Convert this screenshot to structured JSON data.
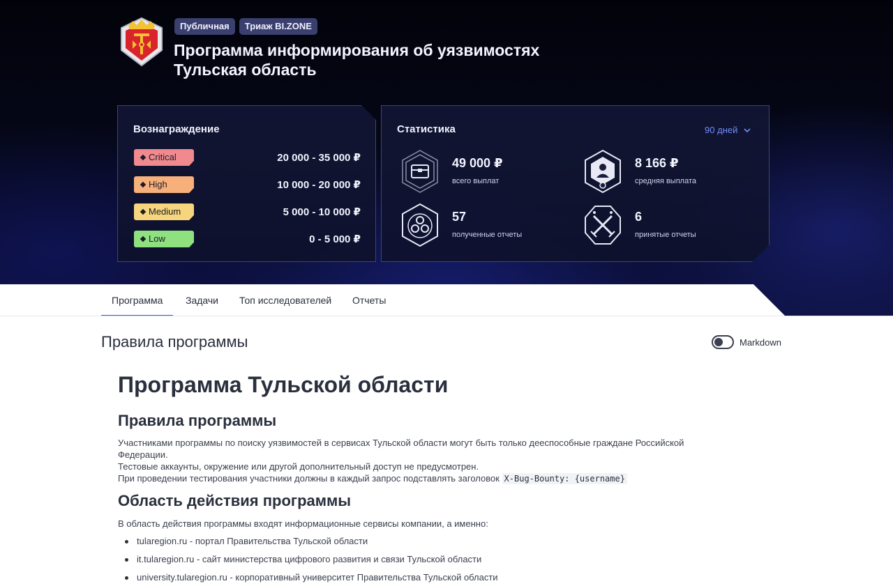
{
  "header": {
    "badges": [
      "Публичная",
      "Триаж BI.ZONE"
    ],
    "title_line1": "Программа информирования об уязвимостях",
    "title_line2": "Тульская область"
  },
  "rewards": {
    "title": "Вознаграждение",
    "rows": [
      {
        "severity": "Critical",
        "range": "20 000 - 35 000 ₽",
        "color": "#f08a8f"
      },
      {
        "severity": "High",
        "range": "10 000 - 20 000 ₽",
        "color": "#f7b07a"
      },
      {
        "severity": "Medium",
        "range": "5 000 - 10 000 ₽",
        "color": "#f7d57c"
      },
      {
        "severity": "Low",
        "range": "0 - 5 000 ₽",
        "color": "#8fe07f"
      }
    ]
  },
  "stats": {
    "title": "Статистика",
    "period": "90 дней",
    "items": [
      {
        "value": "49 000 ₽",
        "label": "всего выплат",
        "icon": "payout-chest-icon"
      },
      {
        "value": "8 166 ₽",
        "label": "средняя выплата",
        "icon": "researcher-badge-icon"
      },
      {
        "value": "57",
        "label": "полученные отчеты",
        "icon": "reports-received-icon"
      },
      {
        "value": "6",
        "label": "принятые отчеты",
        "icon": "crossed-swords-icon"
      }
    ]
  },
  "tabs": [
    {
      "label": "Программа",
      "active": true
    },
    {
      "label": "Задачи",
      "active": false
    },
    {
      "label": "Топ исследователей",
      "active": false
    },
    {
      "label": "Отчеты",
      "active": false
    }
  ],
  "content": {
    "section_title": "Правила программы",
    "markdown_label": "Markdown",
    "markdown_toggle": "off",
    "h1": "Программа Тульской области",
    "rules_heading": "Правила программы",
    "rules_p1_line1": "Участниками программы по поиску уязвимостей в сервисах Тульской области могут быть только дееспособные граждане Российской",
    "rules_p1_line2": "Федерации.",
    "rules_p2": "Тестовые аккаунты, окружение или другой дополнительный доступ не предусмотрен.",
    "rules_p3": "При проведении тестирования участники должны в каждый запрос подставлять заголовок",
    "rules_p3_code": "X-Bug-Bounty: {username}",
    "scope_heading": "Область действия программы",
    "scope_intro": "В область действия программы входят информационные сервисы компании, а именно:",
    "scope_items": [
      "tularegion.ru - портал Правительства Тульской области",
      "it.tularegion.ru - сайт министерства цифрового развития и связи Тульской области",
      "university.tularegion.ru - корпоративный университет Правительства Тульской области"
    ]
  }
}
